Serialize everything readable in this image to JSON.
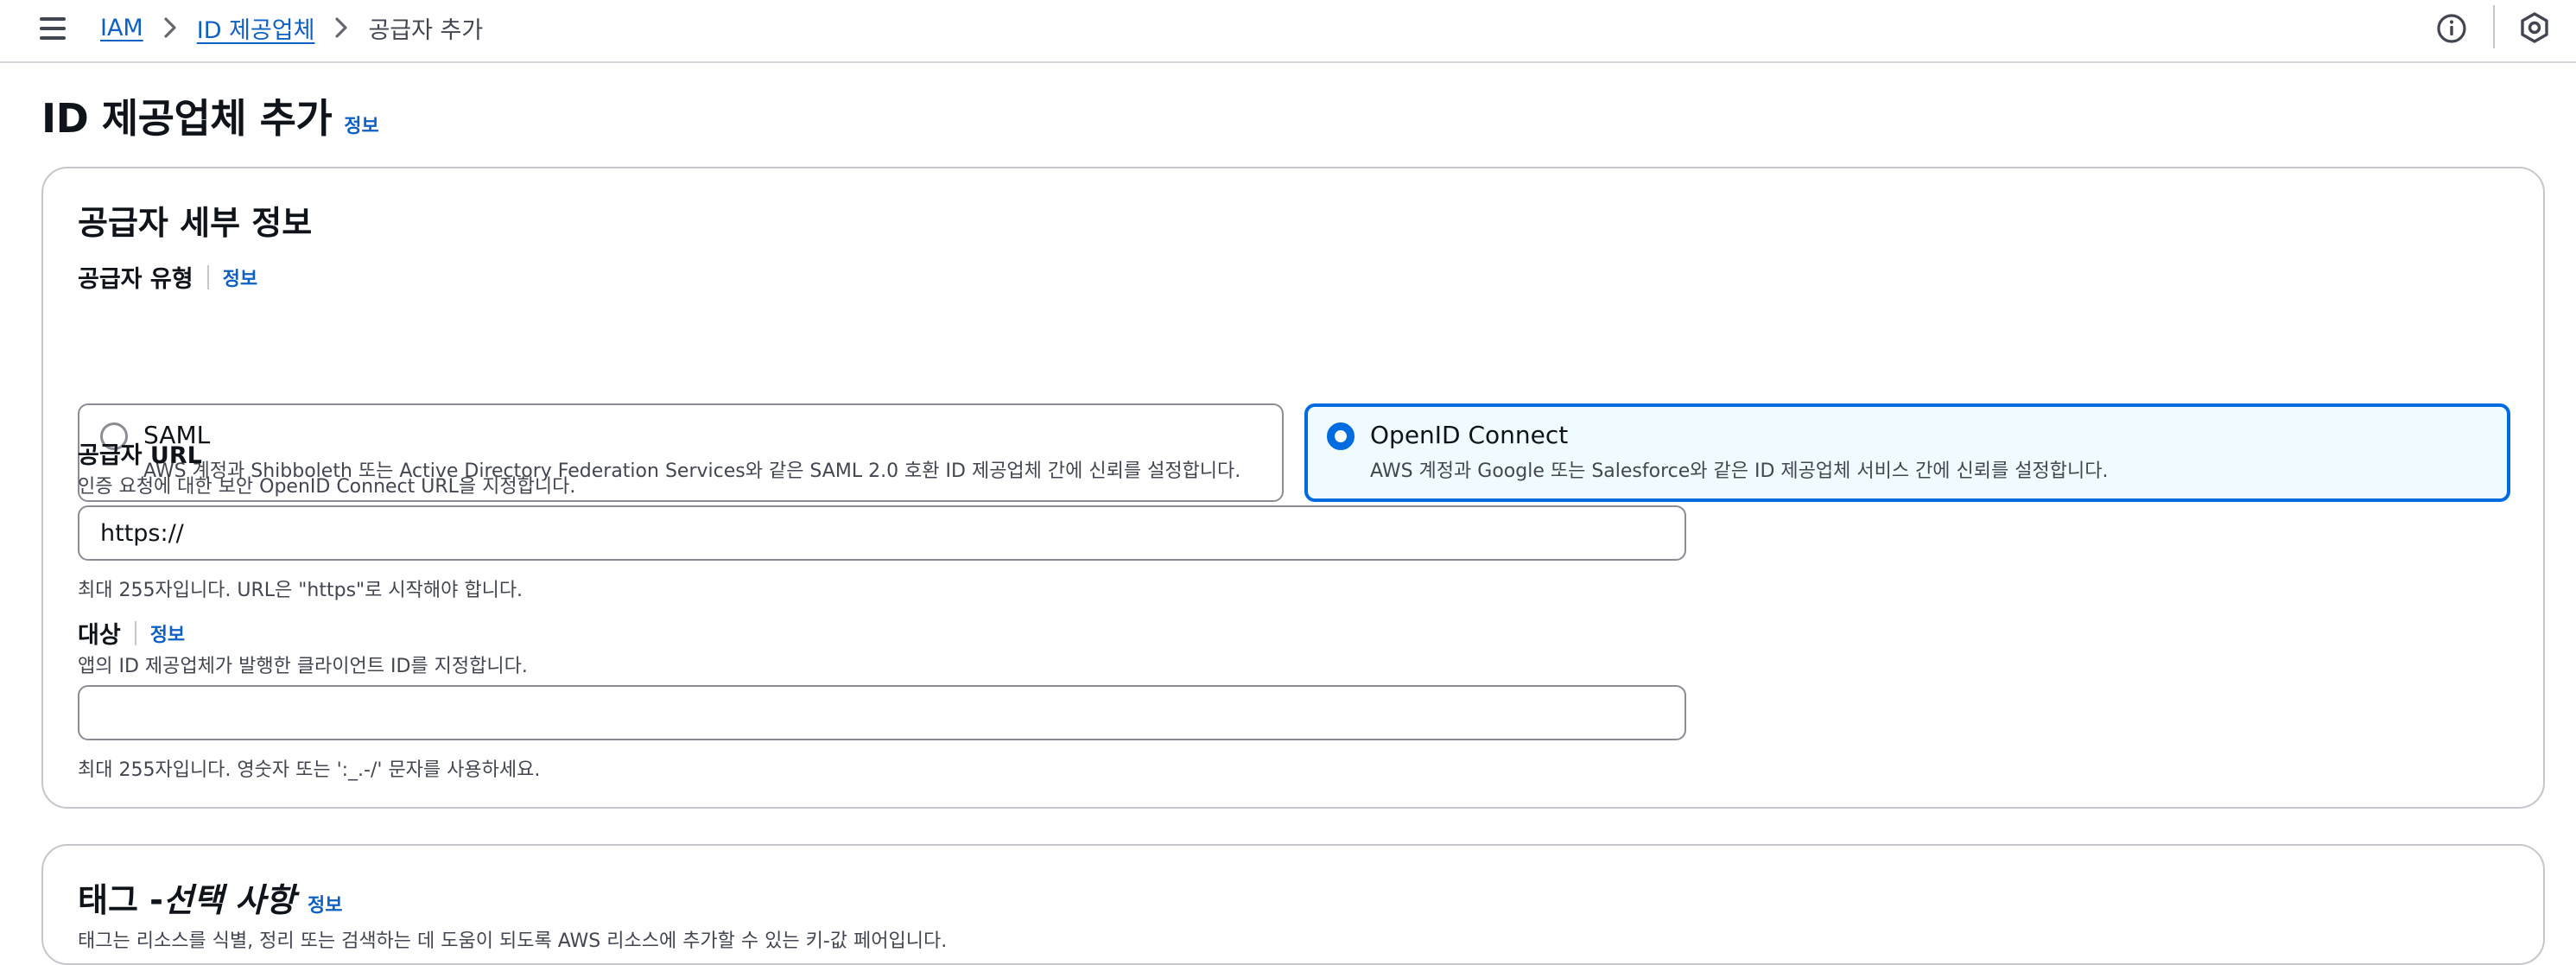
{
  "breadcrumb": {
    "items": [
      {
        "label": "IAM"
      },
      {
        "label": "ID 제공업체"
      }
    ],
    "current": "공급자 추가"
  },
  "page": {
    "title": "ID 제공업체 추가",
    "info_label": "정보"
  },
  "provider_details": {
    "heading": "공급자 세부 정보",
    "provider_type": {
      "label": "공급자 유형",
      "info_label": "정보",
      "options": [
        {
          "title": "SAML",
          "description": "AWS 계정과 Shibboleth 또는 Active Directory Federation Services와 같은 SAML 2.0 호환 ID 제공업체 간에 신뢰를 설정합니다.",
          "selected": false
        },
        {
          "title": "OpenID Connect",
          "description": "AWS 계정과 Google 또는 Salesforce와 같은 ID 제공업체 서비스 간에 신뢰를 설정합니다.",
          "selected": true
        }
      ]
    },
    "provider_url": {
      "label": "공급자 URL",
      "description": "인증 요청에 대한 보안 OpenID Connect URL을 지정합니다.",
      "value": "https://",
      "constraint": "최대 255자입니다. URL은 \"https\"로 시작해야 합니다."
    },
    "audience": {
      "label": "대상",
      "info_label": "정보",
      "description": "앱의 ID 제공업체가 발행한 클라이언트 ID를 지정합니다.",
      "value": "",
      "constraint": "최대 255자입니다. 영숫자 또는 ':_.-/' 문자를 사용하세요."
    }
  },
  "tags": {
    "heading_prefix": "태그 - ",
    "heading_optional": "선택 사항",
    "info_label": "정보",
    "description": "태그는 리소스를 식별, 정리 또는 검색하는 데 도움이 되도록 AWS 리소스에 추가할 수 있는 키-값 페어입니다."
  },
  "colors": {
    "link": "#0f60c4",
    "selected_border": "#006ce0",
    "selected_background": "#f0fbff",
    "border": "#c6c6cd",
    "text": "#0f141a",
    "secondary_text": "#424650"
  },
  "icons": {
    "menu": "hamburger-menu-icon",
    "info": "info-circle-icon",
    "notifications": "hexagon-settings-icon",
    "separator": "chevron-right-icon"
  }
}
